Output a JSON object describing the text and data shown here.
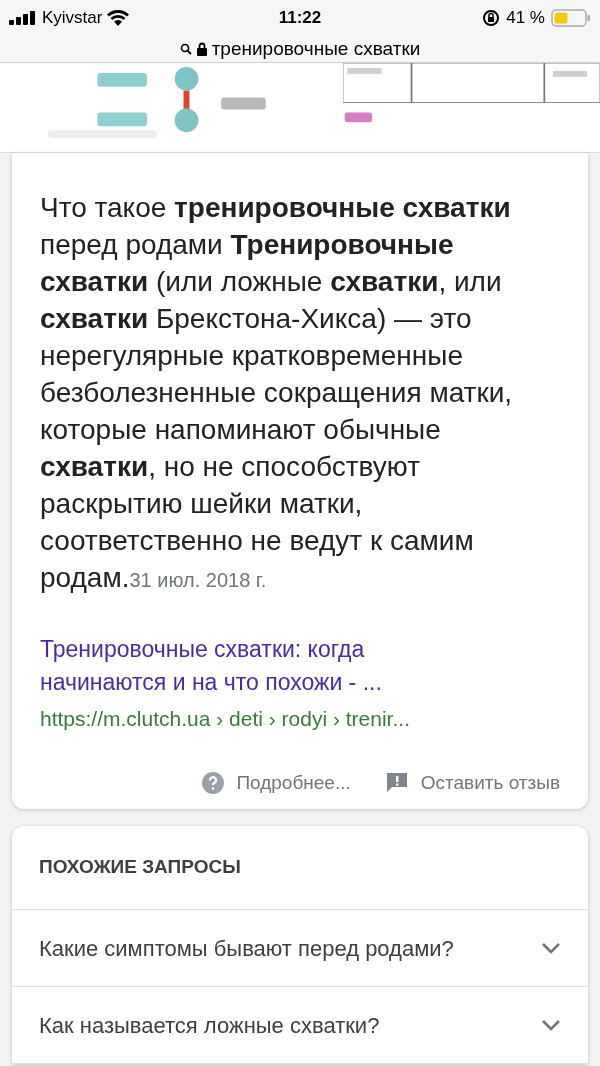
{
  "status_bar": {
    "carrier": "Kyivstar",
    "time": "11:22",
    "battery": "41 %"
  },
  "address_bar": {
    "query": "тренировочные схватки"
  },
  "answer": {
    "text": "Что такое **тренировочные схватки** перед родами **Тренировочные схватки** (или ложные **схватки**, или **схватки** Брекстона-Хикса) — это нерегулярные кратковременные безболезненные сокращения матки, которые напоминают обычные **схватки**, но не способствуют раскрытию шейки матки, соответственно не ведут к самим родам.",
    "date": "31 июл. 2018 г.",
    "link_title": "Тренировочные схватки: когда начинаются и на что похожи - ...",
    "url": "https://m.clutch.ua › deti › rodyi › trenir...",
    "footer": [
      "Подробнее...",
      "Оставить отзыв"
    ]
  },
  "related": {
    "title": "ПОХОЖИЕ ЗАПРОСЫ",
    "items": [
      {
        "text": "Какие симптомы бывают перед родами?",
        "expanded": false
      },
      {
        "text": "Как называется ложные схватки?",
        "expanded": false
      }
    ]
  }
}
